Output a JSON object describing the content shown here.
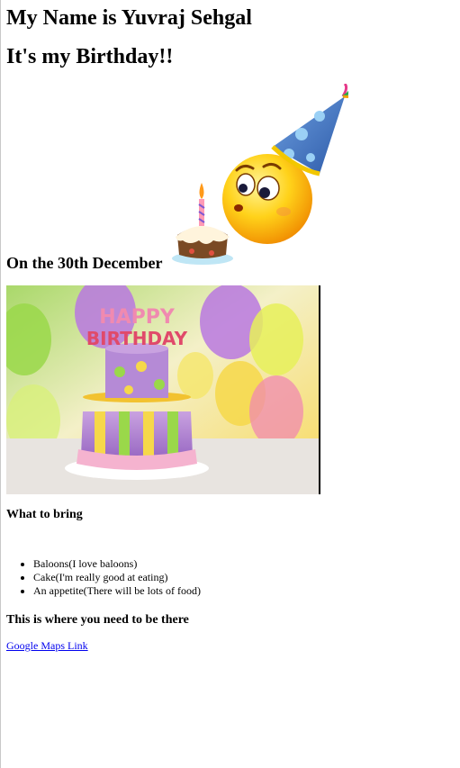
{
  "headings": {
    "name": "My Name is Yuvraj Sehgal",
    "birthday": "It's my Birthday!!",
    "date": "On the 30th December",
    "what_to_bring": "What to bring",
    "where": "This is where you need to be there"
  },
  "images": {
    "emoji": "birthday-emoji-with-cake",
    "cake_photo": "happy-birthday-cake-photo",
    "cake_photo_candles": "HAPPY BIRTHDAY"
  },
  "bring_list": [
    "Baloons(I love baloons)",
    "Cake(I'm really good at eating)",
    "An appetite(There will be lots of food)"
  ],
  "link": {
    "label": "Google Maps Link"
  },
  "colors": {
    "link": "#0000ee",
    "text": "#000000",
    "background": "#ffffff"
  }
}
